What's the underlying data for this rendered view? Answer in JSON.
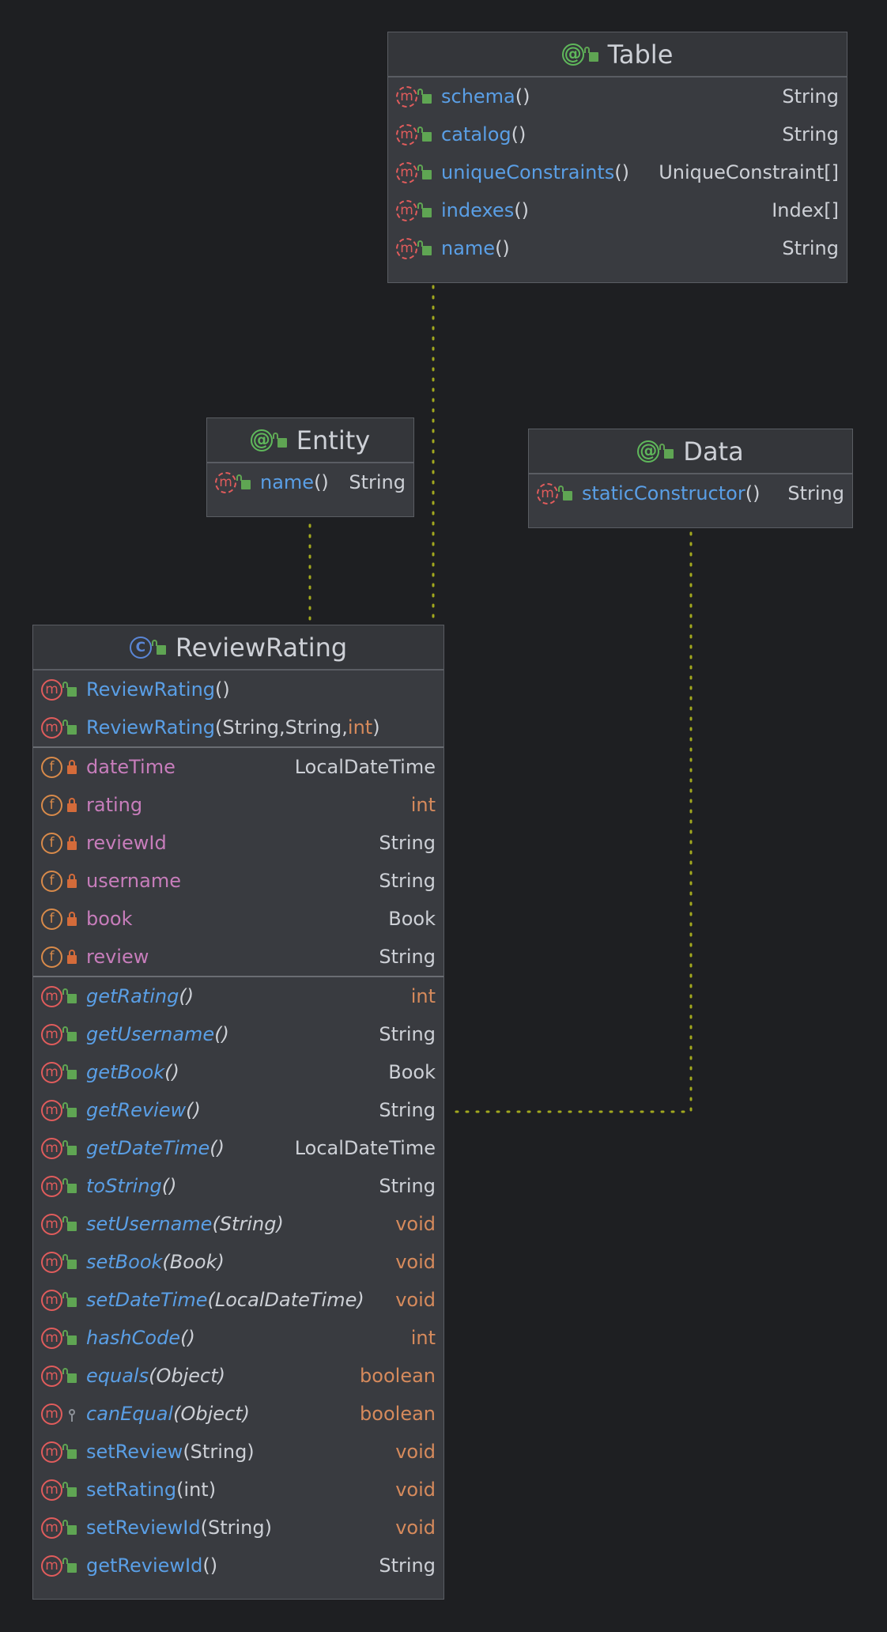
{
  "colors": {
    "background": "#1e1f22",
    "box": "#393b40",
    "method_name": "#5a9fe6",
    "field_name": "#c77dbb",
    "keyword": "#d68a5c",
    "connector": "#a2a81e"
  },
  "classes": {
    "table": {
      "kind": "annotation",
      "name": "Table",
      "members": [
        {
          "icon": "m",
          "name": "schema",
          "params": "()",
          "type": "String"
        },
        {
          "icon": "m",
          "name": "catalog",
          "params": "()",
          "type": "String"
        },
        {
          "icon": "m",
          "name": "uniqueConstraints",
          "params": "()",
          "type": "UniqueConstraint[]"
        },
        {
          "icon": "m",
          "name": "indexes",
          "params": "()",
          "type": "Index[]"
        },
        {
          "icon": "m",
          "name": "name",
          "params": "()",
          "type": "String"
        }
      ]
    },
    "entity": {
      "kind": "annotation",
      "name": "Entity",
      "members": [
        {
          "icon": "m",
          "name": "name",
          "params": "()",
          "type": "String"
        }
      ]
    },
    "data": {
      "kind": "annotation",
      "name": "Data",
      "members": [
        {
          "icon": "m",
          "name": "staticConstructor",
          "params": "()",
          "type": "String"
        }
      ]
    },
    "review_rating": {
      "kind": "class",
      "name": "ReviewRating",
      "constructors": [
        {
          "name": "ReviewRating",
          "params_open": "(",
          "params": [],
          "params_close": ")"
        },
        {
          "name": "ReviewRating",
          "params_open": "(",
          "params": [
            "String, ",
            "String, ",
            "int"
          ],
          "params_close": ")"
        }
      ],
      "fields": [
        {
          "name": "dateTime",
          "type": "LocalDateTime"
        },
        {
          "name": "rating",
          "type": "int"
        },
        {
          "name": "reviewId",
          "type": "String"
        },
        {
          "name": "username",
          "type": "String"
        },
        {
          "name": "book",
          "type": "Book"
        },
        {
          "name": "review",
          "type": "String"
        }
      ],
      "methods": [
        {
          "name": "getRating",
          "params": "()",
          "type": "int",
          "italic": true,
          "visibility": "public"
        },
        {
          "name": "getUsername",
          "params": "()",
          "type": "String",
          "italic": true,
          "visibility": "public"
        },
        {
          "name": "getBook",
          "params": "()",
          "type": "Book",
          "italic": true,
          "visibility": "public"
        },
        {
          "name": "getReview",
          "params": "()",
          "type": "String",
          "italic": true,
          "visibility": "public"
        },
        {
          "name": "getDateTime",
          "params": "()",
          "type": "LocalDateTime",
          "italic": true,
          "visibility": "public"
        },
        {
          "name": "toString",
          "params": "()",
          "type": "String",
          "italic": true,
          "visibility": "public"
        },
        {
          "name": "setUsername",
          "params": "(String)",
          "type": "void",
          "italic": true,
          "visibility": "public"
        },
        {
          "name": "setBook",
          "params": "(Book)",
          "type": "void",
          "italic": true,
          "visibility": "public"
        },
        {
          "name": "setDateTime",
          "params": "(LocalDateTime)",
          "type": "void",
          "italic": true,
          "visibility": "public"
        },
        {
          "name": "hashCode",
          "params": "()",
          "type": "int",
          "italic": true,
          "visibility": "public"
        },
        {
          "name": "equals",
          "params": "(Object)",
          "type": "boolean",
          "italic": true,
          "visibility": "public"
        },
        {
          "name": "canEqual",
          "params": "(Object)",
          "type": "boolean",
          "italic": true,
          "visibility": "protected"
        },
        {
          "name": "setReview",
          "params": "(String)",
          "type": "void",
          "italic": false,
          "visibility": "public"
        },
        {
          "name": "setRating",
          "params": "(int)",
          "type": "void",
          "italic": false,
          "visibility": "public"
        },
        {
          "name": "setReviewId",
          "params": "(String)",
          "type": "void",
          "italic": false,
          "visibility": "public"
        },
        {
          "name": "getReviewId",
          "params": "()",
          "type": "String",
          "italic": false,
          "visibility": "public"
        }
      ]
    }
  },
  "icons": {
    "annotation": "@",
    "class": "C",
    "method": "m",
    "field": "f"
  }
}
